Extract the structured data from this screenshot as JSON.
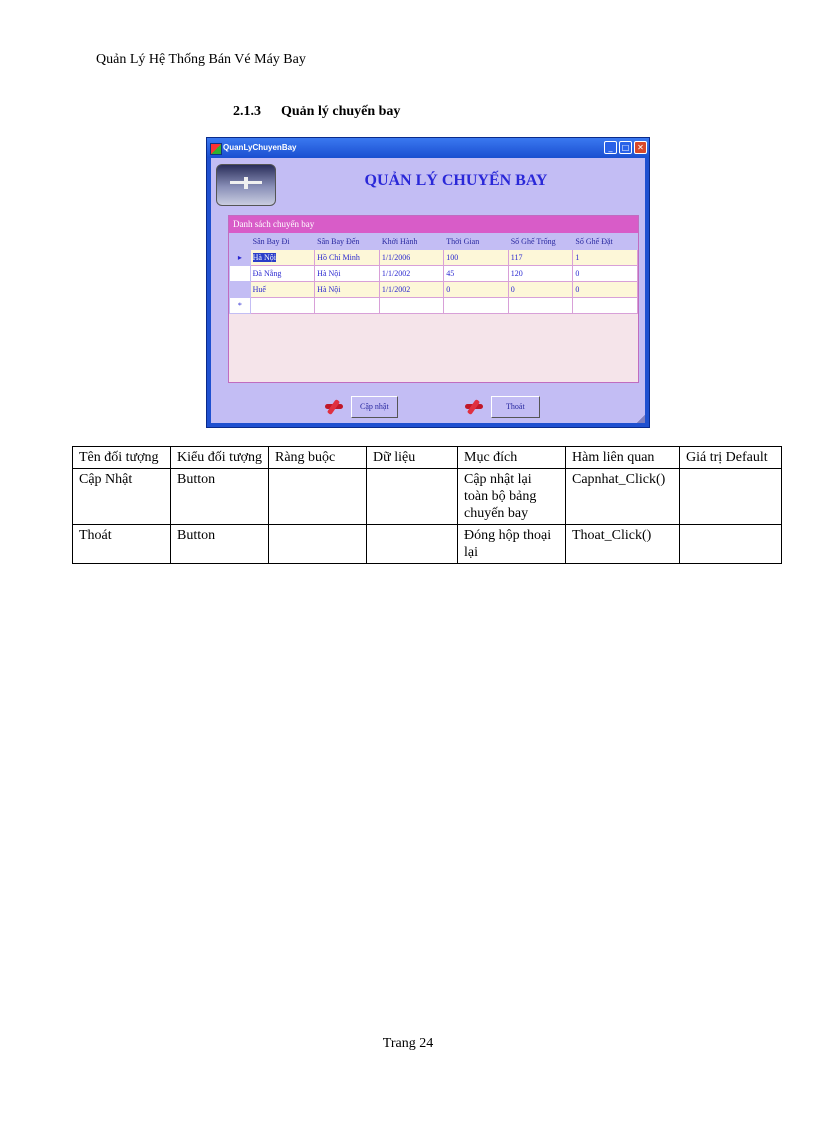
{
  "document": {
    "header": "Quản Lý Hệ Thống Bán Vé Máy Bay",
    "section_number": "2.1.3",
    "section_title": "Quản lý chuyến bay",
    "footer": "Trang 24"
  },
  "window": {
    "title": "QuanLyChuyenBay",
    "form_title": "QUẢN LÝ CHUYẾN BAY",
    "grid_caption": "Danh sách chuyến bay",
    "columns": [
      "Sân Bay Đi",
      "Sân Bay Đến",
      "Khởi Hành",
      "Thời Gian",
      "Số Ghế Trống",
      "Số Ghế Đặt"
    ],
    "rows": [
      [
        "Hà Nội",
        "Hồ Chí Minh",
        "1/1/2006",
        "100",
        "117",
        "1"
      ],
      [
        "Đà Nẵng",
        "Hà Nội",
        "1/1/2002",
        "45",
        "120",
        "0"
      ],
      [
        "Huế",
        "Hà Nội",
        "1/1/2002",
        "0",
        "0",
        "0"
      ]
    ],
    "current_row_marker": "▸",
    "new_row_marker": "*",
    "buttons": {
      "capnhat": "Cập nhật",
      "thoat": "Thoát"
    }
  },
  "properties_table": {
    "headers": [
      "Tên đối tượng",
      "Kiểu đối tượng",
      "Ràng buộc",
      "Dữ liệu",
      "Mục đích",
      "Hàm liên quan",
      "Giá trị Default"
    ],
    "rows": [
      [
        "Cập Nhật",
        "Button",
        "",
        "",
        "Cập nhật lại toàn bộ bảng chuyến bay",
        "Capnhat_Click()",
        ""
      ],
      [
        "Thoát",
        "Button",
        "",
        "",
        "Đóng hộp thoại lại",
        "Thoat_Click()",
        ""
      ]
    ]
  }
}
